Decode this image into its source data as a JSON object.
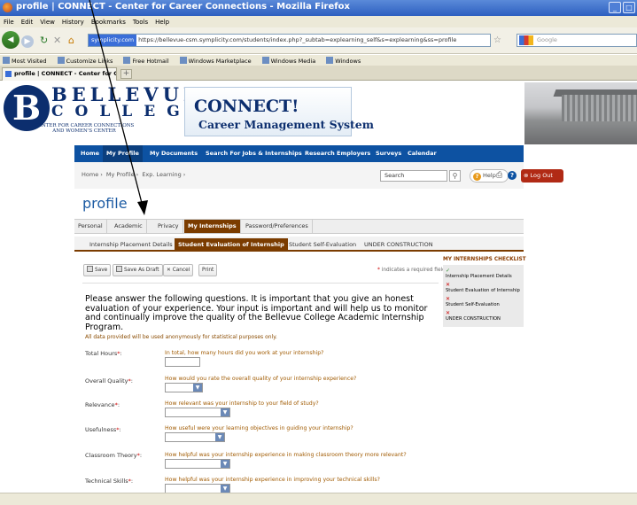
{
  "window": {
    "title": "profile | CONNECT - Center for Career Connections - Mozilla Firefox"
  },
  "menubar": [
    "File",
    "Edit",
    "View",
    "History",
    "Bookmarks",
    "Tools",
    "Help"
  ],
  "url": {
    "site": "symplicity.com",
    "address": "https://bellevue-csm.symplicity.com/students/index.php?_subtab=explearning_self&s=explearning&ss=profile"
  },
  "search_engine": {
    "placeholder": "Google"
  },
  "bookmarks": [
    "Most Visited",
    "Customize Links",
    "Free Hotmail",
    "Windows Marketplace",
    "Windows Media",
    "Windows"
  ],
  "browser_tab": {
    "label": "profile | CONNECT - Center for C...",
    "new_tab": "+"
  },
  "header": {
    "college_line1": "BELLEVUE",
    "college_line2": "COLLEGE",
    "college_sub1": "CENTER FOR CAREER CONNECTIONS",
    "college_sub2": "AND WOMEN'S CENTER",
    "connect_title": "CONNECT!",
    "connect_subtitle": "Career Management System"
  },
  "sitenav": [
    "Home",
    "My Profile",
    "My Documents",
    "Search For Jobs & Internships",
    "Research Employers",
    "Surveys",
    "Calendar"
  ],
  "breadcrumb": [
    "Home",
    "My Profile",
    "Exp. Learning"
  ],
  "search": {
    "label": "Search"
  },
  "toolbar_right": {
    "help": "Help",
    "logout": "Log Out"
  },
  "page_title": "profile",
  "tabs_primary": [
    "Personal",
    "Academic",
    "Privacy",
    "My Internships",
    "Password/Preferences"
  ],
  "tabs_secondary": [
    "Internship Placement Details",
    "Student Evaluation of Internship",
    "Student Self-Evaluation",
    "UNDER CONSTRUCTION"
  ],
  "form_buttons": {
    "save": "Save",
    "save_draft": "Save As Draft",
    "cancel": "Cancel",
    "print": "Print"
  },
  "required_note": "indicates a required field",
  "intro": "Please answer the following questions. It is important that you give an honest evaluation of your experience. Your input is important and will help us to monitor and continually improve the quality of the Bellevue College Academic Internship Program.",
  "anon_note": "All data provided will be used anonymously for statistical purposes only.",
  "questions": [
    {
      "label": "Total Hours",
      "text": "In total, how many hours did you work at your internship?"
    },
    {
      "label": "Overall Quality",
      "text": "How would you rate the overall quality of your internship experience?"
    },
    {
      "label": "Relevance",
      "text": "How relevant was your internship to your field of study?"
    },
    {
      "label": "Usefulness",
      "text": "How useful were your learning objectives in guiding your internship?"
    },
    {
      "label": "Classroom Theory",
      "text": "How helpful was your internship experience in making classroom theory more relevant?"
    },
    {
      "label": "Technical Skills",
      "text": "How helpful was your internship experience in improving your technical skills?"
    }
  ],
  "checklist": {
    "title": "MY INTERNSHIPS CHECKLIST",
    "items": [
      {
        "label": "Internship Placement Details",
        "status": "done"
      },
      {
        "label": "Student Evaluation of Internship",
        "status": "todo"
      },
      {
        "label": "Student Self-Evaluation",
        "status": "todo"
      },
      {
        "label": "UNDER CONSTRUCTION",
        "status": "todo"
      }
    ]
  }
}
